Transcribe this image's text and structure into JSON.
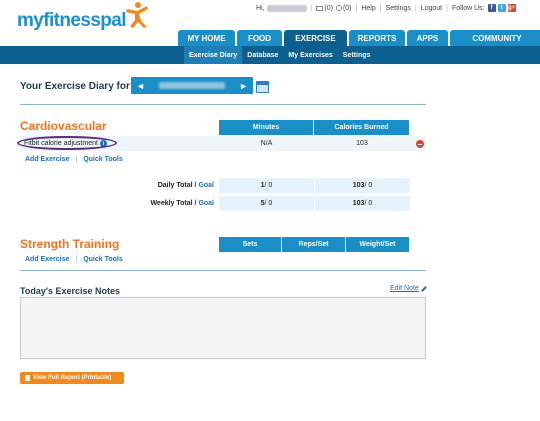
{
  "brand": {
    "name": "myfitnesspal"
  },
  "toplinks": {
    "greeting": "Hi,",
    "messages": "(0)",
    "friends": "(0)",
    "help": "Help",
    "settings": "Settings",
    "logout": "Logout",
    "follow": "Follow Us:",
    "social": [
      "f",
      "t",
      "g+"
    ]
  },
  "nav": {
    "tabs": [
      "MY HOME",
      "FOOD",
      "EXERCISE",
      "REPORTS",
      "APPS",
      "COMMUNITY"
    ],
    "active": "EXERCISE"
  },
  "subnav": {
    "items": [
      "Exercise Diary",
      "Database",
      "My Exercises",
      "Settings"
    ],
    "active": "Exercise Diary"
  },
  "diary": {
    "label": "Your Exercise Diary for:",
    "prev": "◄",
    "next": "►"
  },
  "cardio": {
    "title": "Cardiovascular",
    "headers": [
      "Minutes",
      "Calories Burned"
    ],
    "rows": [
      {
        "name": "Fitbit calorie adjustment",
        "minutes": "N/A",
        "calories": "103"
      }
    ],
    "add_exercise": "Add Exercise",
    "quick_tools": "Quick Tools"
  },
  "totals": {
    "daily": {
      "label": "Daily Total / ",
      "goal_word": "Goal",
      "minutes": "1",
      "minutes_goal": " / 0",
      "calories": "103",
      "calories_goal": " / 0"
    },
    "weekly": {
      "label": "Weekly Total / ",
      "goal_word": "Goal",
      "minutes": "5",
      "minutes_goal": " / 0",
      "calories": "103",
      "calories_goal": " / 0"
    }
  },
  "strength": {
    "title": "Strength Training",
    "headers": [
      "Sets",
      "Reps/Set",
      "Weight/Set"
    ],
    "add_exercise": "Add Exercise",
    "quick_tools": "Quick Tools"
  },
  "notes": {
    "title": "Today's Exercise Notes",
    "edit": "Edit Note"
  },
  "report_button": "View Full Report (Printable)",
  "colors": {
    "brand_blue": "#1a8ec6",
    "dark_blue": "#0c5f8f",
    "accent_orange": "#f2741e",
    "annotation_purple": "#5b2d7e"
  }
}
